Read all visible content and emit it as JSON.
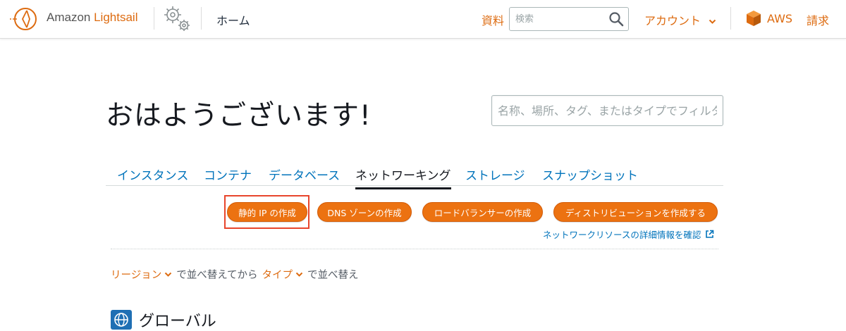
{
  "topbar": {
    "logo_prefix": "Amazon ",
    "logo_brand": "Lightsail",
    "home_label": "ホーム",
    "docs_label": "資料",
    "search_placeholder": "検索",
    "account_label": "アカウント",
    "aws_label": "AWS",
    "billing_label": "請求"
  },
  "main": {
    "greeting": "おはようございます!",
    "search_placeholder": "名称、場所、タグ、またはタイプでフィルタ",
    "tabs": [
      {
        "label": "インスタンス"
      },
      {
        "label": "コンテナ"
      },
      {
        "label": "データベース"
      },
      {
        "label": "ネットワーキング",
        "active": true
      },
      {
        "label": "ストレージ"
      },
      {
        "label": "スナップショット"
      }
    ],
    "actions": [
      {
        "label": "静的 IP の作成"
      },
      {
        "label": "DNS ゾーンの作成"
      },
      {
        "label": "ロードバランサーの作成"
      },
      {
        "label": "ディストリビューションを作成する"
      }
    ],
    "network_link": "ネットワークリソースの詳細情報を確認",
    "sort": {
      "region_label": "リージョン",
      "sep1": "で並べ替えてから",
      "type_label": "タイプ",
      "sep2": "で並べ替え"
    },
    "section_title": "グローバル"
  },
  "colors": {
    "accent": "#dd6b10",
    "button": "#ec7211",
    "link": "#0073bb",
    "highlight": "#e8452c"
  }
}
